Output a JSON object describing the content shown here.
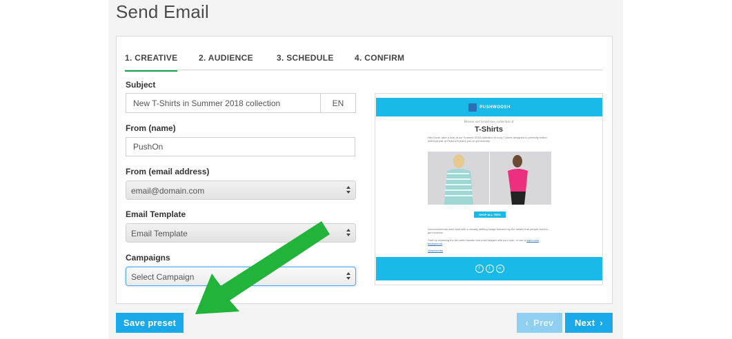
{
  "page": {
    "title": "Send Email"
  },
  "tabs": [
    {
      "label": "1. CREATIVE",
      "active": true
    },
    {
      "label": "2. AUDIENCE",
      "active": false
    },
    {
      "label": "3. SCHEDULE",
      "active": false
    },
    {
      "label": "4. CONFIRM",
      "active": false
    }
  ],
  "form": {
    "subject_label": "Subject",
    "subject_value": "New T-Shirts in Summer 2018 collection",
    "subject_lang": "EN",
    "from_name_label": "From (name)",
    "from_name_value": "PushOn",
    "from_email_label": "From (email address)",
    "from_email_value": "email@domain.com",
    "template_label": "Email Template",
    "template_value": "Email Template",
    "campaigns_label": "Campaigns",
    "campaigns_value": "Select Campaign"
  },
  "preview": {
    "brand": "PUSHWOOSH",
    "subtitle": "Browse our brand new collection of",
    "title": "T-Shirts",
    "description": "Hey Dude, take a look at our Summer 2018 collection of cozy T-shirts designed to perfectly match with that pair of PeachOn jeans you've got recently.",
    "shop_button": "SHOP ALL TEES",
    "body_text_1": "Announcements work best with a visually striking image followed by the details that people need to get involved.",
    "body_text_2": "Start by replacing the full-width header and main images with your own, or use a",
    "body_link": "solid color background",
    "unsubscribe": "Unsubscribe",
    "accent_color": "#19b9e8"
  },
  "actions": {
    "save_preset": "Save preset",
    "prev": "Prev",
    "next": "Next"
  },
  "colors": {
    "primary": "#19a8e8",
    "active_tab": "#1aa554",
    "annotation_arrow": "#22b33a"
  }
}
